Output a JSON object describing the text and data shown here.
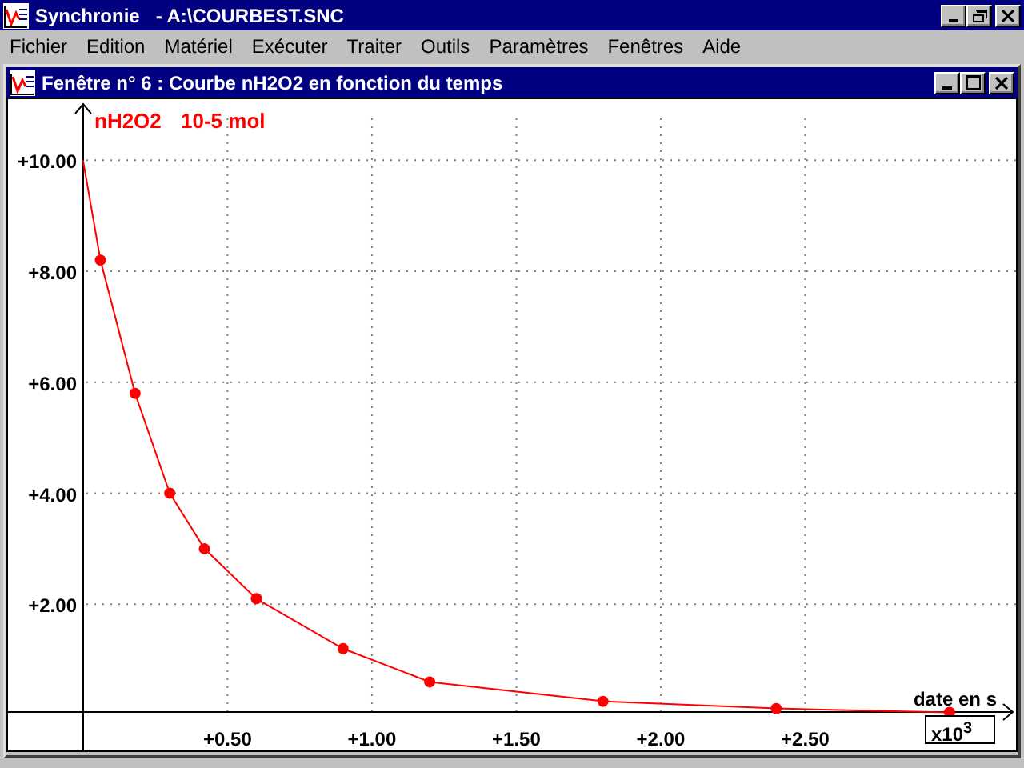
{
  "window": {
    "title": "Synchronie   - A:\\COURBEST.SNC"
  },
  "menu": [
    "Fichier",
    "Edition",
    "Matériel",
    "Exécuter",
    "Traiter",
    "Outils",
    "Paramètres",
    "Fenêtres",
    "Aide"
  ],
  "child_window": {
    "title": "Fenêtre n° 6 : Courbe nH2O2 en fonction du temps",
    "multiplier": "x10$^{3}$",
    "chart_data": {
      "type": "line",
      "ylabel": "10-5 mol",
      "xlabel": "date en s",
      "grid": true,
      "x": [
        0,
        0.06,
        0.18,
        0.3,
        0.42,
        0.6,
        0.9,
        1.2,
        1.8,
        2.4,
        3.0
      ],
      "series": [
        {
          "name": "nH2O2",
          "color": "#ff0000",
          "marker": "circle",
          "values": [
            10.0,
            8.2,
            5.8,
            4.0,
            3.0,
            2.1,
            1.2,
            0.6,
            0.25,
            0.12,
            0.05
          ]
        }
      ],
      "xlim": [
        -0.26,
        3.23
      ],
      "ylim": [
        0,
        11.1
      ],
      "xticks": [
        {
          "value": 0.5,
          "label": "+0.50"
        },
        {
          "value": 1.0,
          "label": "+1.00"
        },
        {
          "value": 1.5,
          "label": "+1.50"
        },
        {
          "value": 2.0,
          "label": "+2.00"
        },
        {
          "value": 2.5,
          "label": "+2.50"
        }
      ],
      "yticks": [
        {
          "value": 2,
          "label": "+2.00"
        },
        {
          "value": 4,
          "label": "+4.00"
        },
        {
          "value": 6,
          "label": "+6.00"
        },
        {
          "value": 8,
          "label": "+8.00"
        },
        {
          "value": 10,
          "label": "+10.00"
        }
      ]
    }
  }
}
